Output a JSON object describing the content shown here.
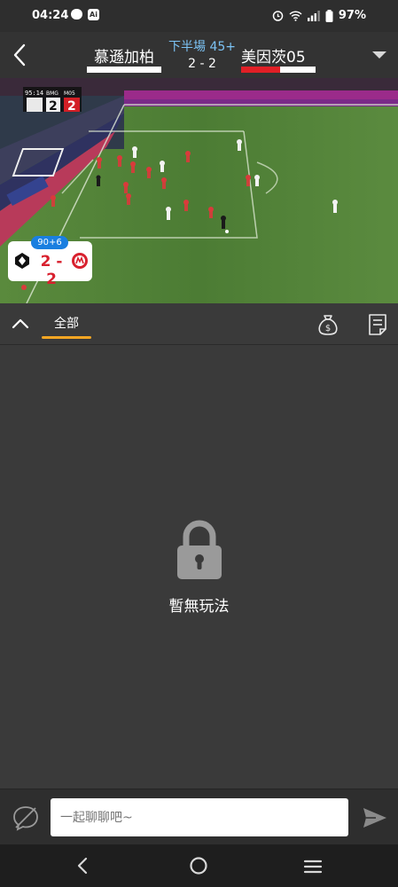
{
  "status_bar": {
    "time": "04:24",
    "app_badge": "Ai",
    "battery": "97%"
  },
  "match": {
    "home_team": "慕遜加柏",
    "away_team": "美因茨05",
    "period": "下半場 45+",
    "score": "2 - 2",
    "home_bar_color": "#ffffff",
    "away_bar_color": "#e11f26",
    "period_color": "#7cc3f5"
  },
  "video": {
    "minute": "90+6",
    "score": "2 - 2",
    "overlay_home_abbr": "BMG",
    "overlay_away_abbr": "M05",
    "overlay_home_score": "2",
    "overlay_away_score": "2",
    "overlay_clock": "95:14"
  },
  "tabs": {
    "items": [
      {
        "label": "全部",
        "active": true
      }
    ],
    "accent": "#f5a623",
    "icons": [
      "money-bag-icon",
      "document-icon"
    ]
  },
  "empty_state": {
    "message": "暫無玩法",
    "icon": "lock-icon"
  },
  "chat": {
    "placeholder": "一起聊聊吧~",
    "icons": [
      "chat-off-icon",
      "send-icon"
    ]
  },
  "nav": {
    "icons": [
      "back-icon",
      "home-icon",
      "recent-apps-icon"
    ]
  }
}
